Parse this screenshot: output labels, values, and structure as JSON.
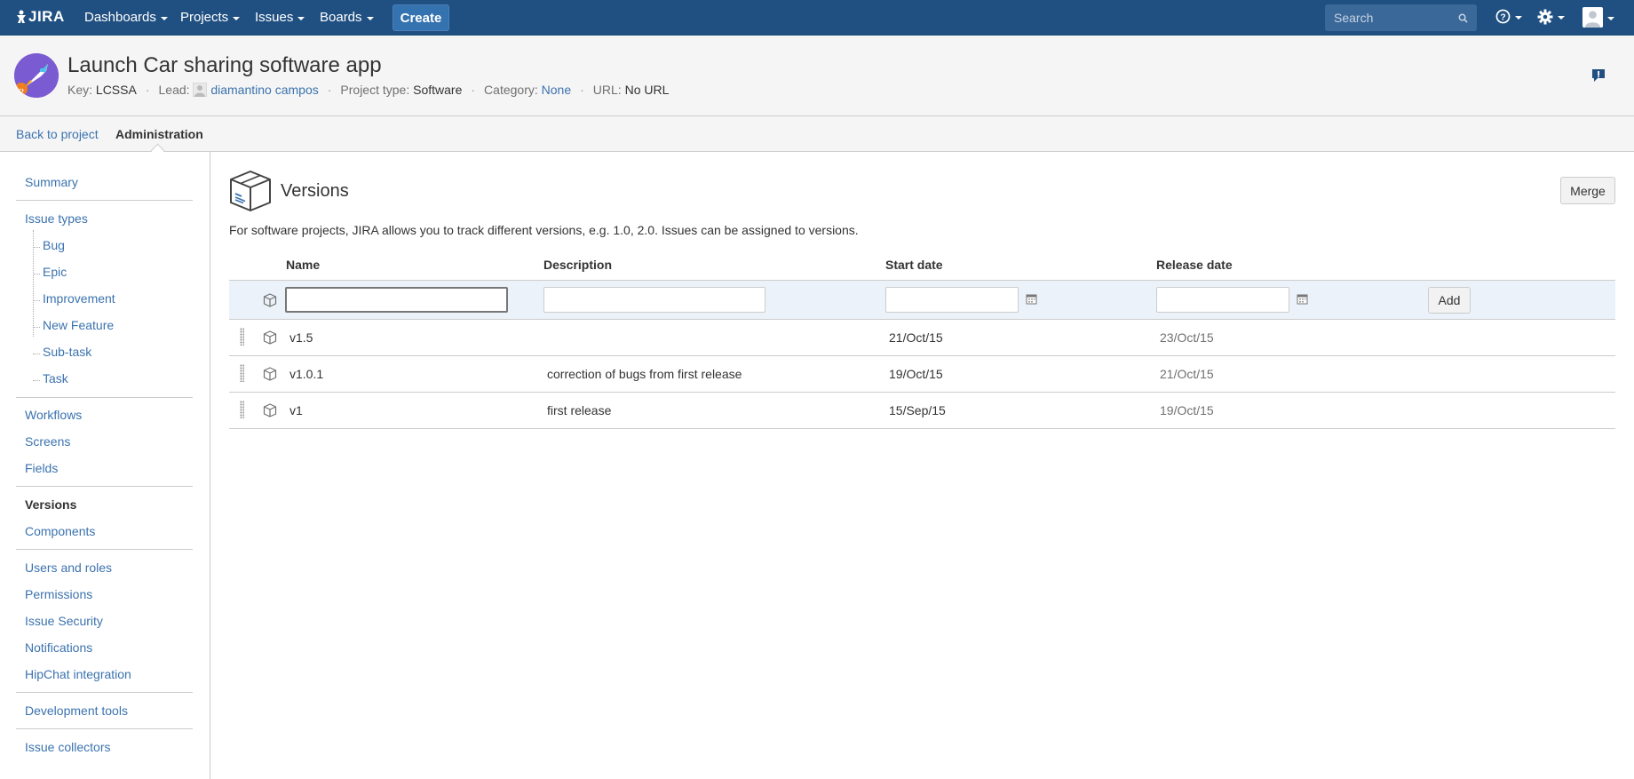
{
  "topnav": {
    "logo": "JIRA",
    "menus": [
      {
        "label": "Dashboards"
      },
      {
        "label": "Projects"
      },
      {
        "label": "Issues"
      },
      {
        "label": "Boards"
      }
    ],
    "create_label": "Create",
    "search_placeholder": "Search"
  },
  "project": {
    "title": "Launch Car sharing software app",
    "key_label": "Key:",
    "key": "LCSSA",
    "lead_label": "Lead:",
    "lead": "diamantino campos",
    "type_label": "Project type:",
    "type": "Software",
    "category_label": "Category:",
    "category": "None",
    "url_label": "URL:",
    "url": "No URL"
  },
  "tabs": {
    "back": "Back to project",
    "admin": "Administration"
  },
  "sidebar": {
    "summary": "Summary",
    "issue_types": "Issue types",
    "issue_type_items": [
      "Bug",
      "Epic",
      "Improvement",
      "New Feature",
      "Sub-task",
      "Task"
    ],
    "workflows": "Workflows",
    "screens": "Screens",
    "fields": "Fields",
    "versions": "Versions",
    "components": "Components",
    "users_roles": "Users and roles",
    "permissions": "Permissions",
    "issue_security": "Issue Security",
    "notifications": "Notifications",
    "hipchat": "HipChat integration",
    "dev_tools": "Development tools",
    "issue_collectors": "Issue collectors"
  },
  "main": {
    "title": "Versions",
    "merge_label": "Merge",
    "intro": "For software projects, JIRA allows you to track different versions, e.g. 1.0, 2.0. Issues can be assigned to versions.",
    "columns": [
      "Name",
      "Description",
      "Start date",
      "Release date"
    ],
    "add_label": "Add",
    "rows": [
      {
        "name": "v1.5",
        "description": "",
        "start": "21/Oct/15",
        "release": "23/Oct/15"
      },
      {
        "name": "v1.0.1",
        "description": "correction of bugs from first release",
        "start": "19/Oct/15",
        "release": "21/Oct/15"
      },
      {
        "name": "v1",
        "description": "first release",
        "start": "15/Sep/15",
        "release": "19/Oct/15"
      }
    ]
  },
  "colors": {
    "topnav_bg": "#205081",
    "link": "#3b73af",
    "create_bg": "#3572b0",
    "add_row_bg": "#ebf2f9"
  }
}
